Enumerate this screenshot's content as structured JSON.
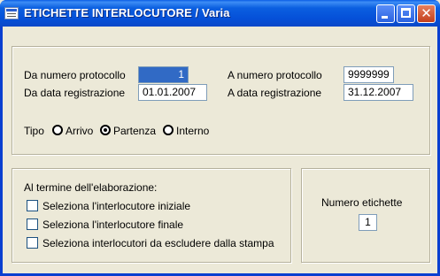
{
  "window": {
    "title": "ETICHETTE INTERLOCUTORE / Varia"
  },
  "range": {
    "da_numero_label": "Da numero protocollo",
    "da_numero_value": "1",
    "a_numero_label": "A  numero protocollo",
    "a_numero_value": "9999999",
    "da_data_label": "Da data registrazione",
    "da_data_value": "01.01.2007",
    "a_data_label": "A  data registrazione",
    "a_data_value": "31.12.2007"
  },
  "tipo": {
    "label": "Tipo",
    "options": [
      {
        "label": "Arrivo",
        "checked": false
      },
      {
        "label": "Partenza",
        "checked": true
      },
      {
        "label": "Interno",
        "checked": false
      }
    ]
  },
  "termine": {
    "heading": "Al termine dell'elaborazione:",
    "options": [
      {
        "label": "Seleziona l'interlocutore iniziale",
        "checked": false
      },
      {
        "label": "Seleziona l'interlocutore finale",
        "checked": false
      },
      {
        "label": "Seleziona interlocutori da escludere dalla stampa",
        "checked": false
      }
    ]
  },
  "etichette": {
    "label": "Numero etichette",
    "value": "1"
  }
}
